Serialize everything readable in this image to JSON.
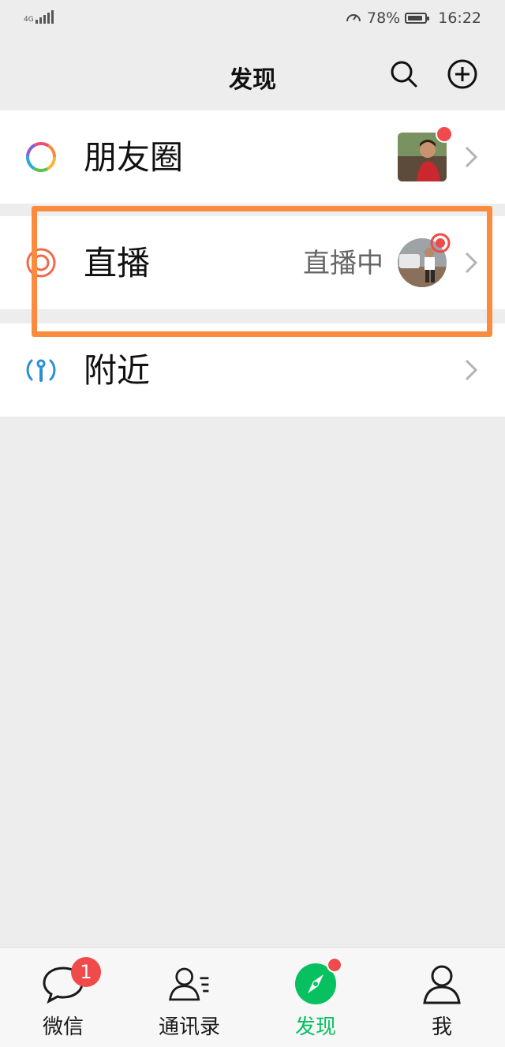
{
  "status_bar": {
    "network": "4G",
    "battery_percent": "78%",
    "battery_level": 0.78,
    "time": "16:22"
  },
  "header": {
    "title": "发现",
    "search_icon": "search-icon",
    "add_icon": "plus-circle-icon"
  },
  "list": [
    {
      "label": "朋友圈",
      "icon": "moments-icon",
      "has_thumb": true,
      "has_dot": true
    },
    {
      "label": "直播",
      "icon": "live-icon",
      "status": "直播中",
      "has_thumb": true
    },
    {
      "label": "附近",
      "icon": "nearby-icon"
    }
  ],
  "tabbar": {
    "items": [
      {
        "label": "微信",
        "icon": "chat-icon",
        "badge": "1"
      },
      {
        "label": "通讯录",
        "icon": "contacts-icon"
      },
      {
        "label": "发现",
        "icon": "compass-icon",
        "active": true,
        "dot": true
      },
      {
        "label": "我",
        "icon": "person-icon"
      }
    ]
  },
  "colors": {
    "accent": "#07c160",
    "badge": "#f04a4a",
    "highlight": "#fb8c3d",
    "background": "#ededed"
  }
}
